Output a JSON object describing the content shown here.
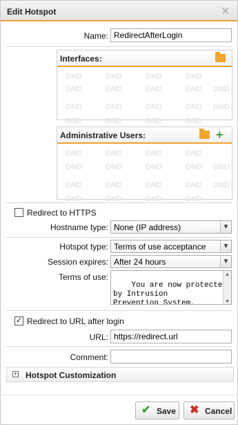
{
  "dialog": {
    "title": "Edit Hotspot",
    "close_icon": "close-icon"
  },
  "name": {
    "label": "Name:",
    "value": "RedirectAfterLogin"
  },
  "interfaces": {
    "title": "Interfaces:",
    "icons": [
      "folder-icon"
    ],
    "placeholder": "DND"
  },
  "admin_users": {
    "title": "Administrative Users:",
    "icons": [
      "folder-icon",
      "plus-icon"
    ],
    "placeholder": "DND"
  },
  "redirect_https": {
    "label": "Redirect to HTTPS",
    "checked": false
  },
  "hostname_type": {
    "label": "Hostname type:",
    "value": "None (IP address)"
  },
  "hotspot_type": {
    "label": "Hotspot type:",
    "value": "Terms of use acceptance"
  },
  "session_expires": {
    "label": "Session expires:",
    "value": "After 24 hours"
  },
  "terms_of_use": {
    "label": "Terms of use:",
    "value": "You are now protected\nby Intrusion\nPrevention System,\nWeb Filter, and IPS"
  },
  "redirect_url": {
    "label": "Redirect to URL after login",
    "checked": true
  },
  "url": {
    "label": "URL:",
    "value": "https://redirect.url"
  },
  "comment": {
    "label": "Comment:",
    "value": ""
  },
  "customization": {
    "title": "Hotspot Customization",
    "expanded": false
  },
  "buttons": {
    "save": "Save",
    "cancel": "Cancel"
  },
  "colors": {
    "accent": "#f0a030",
    "save_icon": "#3aa53a",
    "cancel_icon": "#d22a1e"
  }
}
